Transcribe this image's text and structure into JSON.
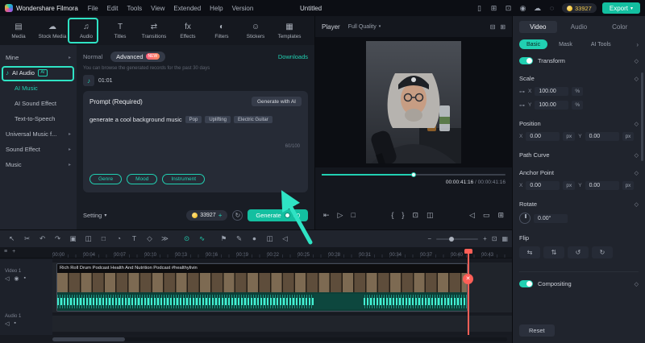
{
  "colors": {
    "accent": "#21d0b2",
    "playhead_red": "#ff5f57",
    "coin_yellow": "#f0b90b"
  },
  "topbar": {
    "logo": "Wondershare Filmora",
    "menus": [
      "File",
      "Edit",
      "Tools",
      "View",
      "Extended",
      "Help",
      "Version"
    ],
    "project_title": "Untitled",
    "right_icons": [
      {
        "name": "device-icon",
        "glyph": "▯"
      },
      {
        "name": "layout-icon",
        "glyph": "⊞"
      },
      {
        "name": "display-icon",
        "glyph": "⊡"
      },
      {
        "name": "screen-record-icon",
        "glyph": "◉"
      },
      {
        "name": "cloud-icon",
        "glyph": "☁"
      },
      {
        "name": "notification-icon",
        "glyph": "◌"
      }
    ],
    "coin_balance": "33927",
    "export_label": "Export",
    "export_caret": "▾"
  },
  "media_tabs": [
    {
      "name": "tab-media",
      "label": "Media",
      "glyph": "▤"
    },
    {
      "name": "tab-stock-media",
      "label": "Stock Media",
      "glyph": "☁"
    },
    {
      "name": "tab-audio",
      "label": "Audio",
      "glyph": "♫"
    },
    {
      "name": "tab-titles",
      "label": "Titles",
      "glyph": "T"
    },
    {
      "name": "tab-transitions",
      "label": "Transitions",
      "glyph": "⇄"
    },
    {
      "name": "tab-effects",
      "label": "Effects",
      "glyph": "fx"
    },
    {
      "name": "tab-filters",
      "label": "Filters",
      "glyph": "◐"
    },
    {
      "name": "tab-stickers",
      "label": "Stickers",
      "glyph": "☺"
    },
    {
      "name": "tab-templates",
      "label": "Templates",
      "glyph": "▦"
    }
  ],
  "sidebar": {
    "mine": "Mine",
    "ai_audio": "AI Audio",
    "ai_audio_badge": "AI",
    "children": [
      {
        "name": "sidebar-item-ai-music",
        "label": "AI Music"
      },
      {
        "name": "sidebar-item-ai-sound-effect",
        "label": "AI Sound Effect"
      },
      {
        "name": "sidebar-item-text-to-speech",
        "label": "Text-to-Speech"
      }
    ],
    "groups": [
      {
        "name": "sidebar-item-universal-music",
        "label": "Universal Music f..."
      },
      {
        "name": "sidebar-item-sound-effect",
        "label": "Sound Effect"
      },
      {
        "name": "sidebar-item-music",
        "label": "Music"
      }
    ]
  },
  "audio_panel": {
    "tab_normal": "Normal",
    "tab_advanced": "Advanced",
    "new_badge": "NEW",
    "downloads": "Downloads",
    "note": "You can browse the generated records for the past 30 days",
    "history_duration": "01:01",
    "prompt_title": "Prompt (Required)",
    "generate_with_ai": "Generate with AI",
    "prompt_text": "generate a cool background music",
    "prompt_tags": [
      "Pop",
      "Uplifting",
      "Electric Guitar"
    ],
    "char_counter": "60/100",
    "category_buttons": [
      {
        "name": "genre-button",
        "label": "Genre"
      },
      {
        "name": "mood-button",
        "label": "Mood"
      },
      {
        "name": "instrument-button",
        "label": "Instrument"
      }
    ],
    "setting_label": "Setting",
    "setting_caret": "▾",
    "coin_balance": "33927",
    "coin_plus": "+",
    "generate_label": "Generate",
    "generate_cost": "60"
  },
  "player": {
    "label": "Player",
    "quality": "Full Quality",
    "quality_caret": "▾",
    "timecode_current": "00:00:41:16",
    "timecode_separator": " / ",
    "timecode_total": "00:00:41:16",
    "head_icons": [
      {
        "name": "player-grid-icon",
        "glyph": "⊟"
      },
      {
        "name": "player-expand-icon",
        "glyph": "⊞"
      }
    ],
    "controls_left": [
      {
        "name": "previous-frame-icon",
        "glyph": "⇤"
      },
      {
        "name": "play-icon",
        "glyph": "▷"
      },
      {
        "name": "stop-icon",
        "glyph": "□"
      }
    ],
    "controls_mid": [
      {
        "name": "mark-in-icon",
        "glyph": "{"
      },
      {
        "name": "mark-out-icon",
        "glyph": "}"
      },
      {
        "name": "crop-preview-icon",
        "glyph": "⊡"
      },
      {
        "name": "snapshot-icon",
        "glyph": "◫"
      }
    ],
    "controls_right": [
      {
        "name": "volume-icon",
        "glyph": "◁"
      },
      {
        "name": "aspect-ratio-icon",
        "glyph": "▭"
      },
      {
        "name": "fullscreen-icon",
        "glyph": "⊞"
      }
    ]
  },
  "properties": {
    "tabs": [
      {
        "name": "props-tab-video",
        "label": "Video"
      },
      {
        "name": "props-tab-audio",
        "label": "Audio"
      },
      {
        "name": "props-tab-color",
        "label": "Color"
      }
    ],
    "subtabs": [
      {
        "name": "props-subtab-basic",
        "label": "Basic"
      },
      {
        "name": "props-subtab-mask",
        "label": "Mask"
      },
      {
        "name": "props-subtab-ai-tools",
        "label": "AI Tools"
      }
    ],
    "subtab_chevron": "›",
    "transform_label": "Transform",
    "scale_label": "Scale",
    "position_label": "Position",
    "path_curve_label": "Path Curve",
    "anchor_label": "Anchor Point",
    "rotate_label": "Rotate",
    "flip_label": "Flip",
    "compositing_label": "Compositing",
    "reset_label": "Reset",
    "x_label": "X",
    "y_label": "Y",
    "scale_x": "100.00",
    "scale_y": "100.00",
    "scale_unit": "%",
    "pos_x": "0.00",
    "pos_y": "0.00",
    "pos_unit": "px",
    "anchor_x": "0.00",
    "anchor_y": "0.00",
    "anchor_unit": "px",
    "rotate_value": "0.00°",
    "keyframe_diamond": "◇",
    "slider_glyph": "⊶",
    "flip_icons": [
      {
        "name": "flip-horizontal-icon",
        "glyph": "⇆"
      },
      {
        "name": "flip-vertical-icon",
        "glyph": "⇅"
      },
      {
        "name": "rotate-ccw-icon",
        "glyph": "↺"
      },
      {
        "name": "rotate-cw-icon",
        "glyph": "↻"
      }
    ]
  },
  "timeline": {
    "ruler": [
      "00:00",
      "00:04",
      "00:07",
      "00:10",
      "00:13",
      "00:16",
      "00:19",
      "00:22",
      "00:25",
      "00:28",
      "00:31",
      "00:34",
      "00:37",
      "00:40",
      "00:43"
    ],
    "clip_title": "Rich Roll Drum Podcast Health And Nutrition Podcast #healthylivin",
    "video_track": "Video 1",
    "audio_track": "Audio 1",
    "toolbar_left": [
      {
        "name": "pointer-tool-icon",
        "glyph": "↖"
      },
      {
        "name": "razor-tool-icon",
        "glyph": "✂"
      },
      {
        "name": "undo-icon",
        "glyph": "↶"
      },
      {
        "name": "redo-icon",
        "glyph": "↷"
      },
      {
        "name": "copy-icon",
        "glyph": "▣"
      },
      {
        "name": "split-icon",
        "glyph": "◫"
      },
      {
        "name": "crop-icon",
        "glyph": "□"
      },
      {
        "name": "speed-icon",
        "glyph": "◔"
      },
      {
        "name": "text-tool-icon",
        "glyph": "T"
      },
      {
        "name": "keyframe-icon",
        "glyph": "◇"
      },
      {
        "name": "more-tools-icon",
        "glyph": "≫"
      }
    ],
    "toolbar_mid_accent": [
      {
        "name": "voiceover-icon",
        "glyph": "⊙"
      },
      {
        "name": "audio-stretch-icon",
        "glyph": "∿"
      }
    ],
    "toolbar_mid": [
      {
        "name": "marker-icon",
        "glyph": "⚑"
      },
      {
        "name": "draw-icon",
        "glyph": "✎"
      },
      {
        "name": "record-icon",
        "glyph": "●"
      },
      {
        "name": "snapshot-icon",
        "glyph": "◫"
      },
      {
        "name": "mute-icon",
        "glyph": "◁"
      }
    ],
    "zoom_out": "−",
    "zoom_in": "+",
    "fit_icon": "⊡",
    "track_manager_icon": "▦",
    "corner_icons": [
      {
        "name": "track-list-icon",
        "glyph": "≡"
      },
      {
        "name": "add-track-icon",
        "glyph": "+"
      }
    ],
    "video_track_icons": [
      {
        "name": "mute-track-icon",
        "glyph": "◁"
      },
      {
        "name": "hide-track-icon",
        "glyph": "◉"
      },
      {
        "name": "lock-track-icon",
        "glyph": "▪"
      }
    ],
    "audio_track_icons": [
      {
        "name": "mute-track-icon",
        "glyph": "◁"
      },
      {
        "name": "lock-track-icon",
        "glyph": "▪"
      }
    ]
  }
}
